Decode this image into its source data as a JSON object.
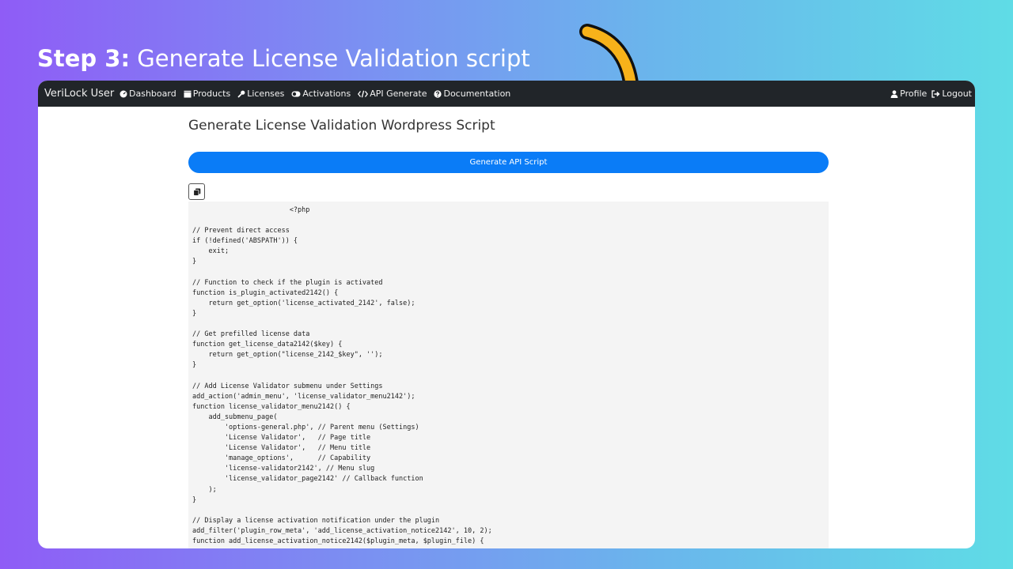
{
  "step": {
    "strong": "Step 3:",
    "rest": " Generate License Validation script"
  },
  "navbar": {
    "brand": "VeriLock User",
    "items": [
      {
        "label": "Dashboard",
        "icon": "dashboard-icon"
      },
      {
        "label": "Products",
        "icon": "products-icon"
      },
      {
        "label": "Licenses",
        "icon": "key-icon"
      },
      {
        "label": "Activations",
        "icon": "toggle-icon"
      },
      {
        "label": "API Generate",
        "icon": "code-icon"
      },
      {
        "label": "Documentation",
        "icon": "question-icon"
      }
    ],
    "right": [
      {
        "label": "Profile",
        "icon": "user-icon"
      },
      {
        "label": "Logout",
        "icon": "logout-icon"
      }
    ]
  },
  "page": {
    "heading": "Generate License Validation Wordpress Script",
    "generate_button": "Generate API Script",
    "copy_icon": "copy-icon"
  },
  "code": "                        <?php\n\n// Prevent direct access\nif (!defined('ABSPATH')) {\n    exit;\n}\n\n// Function to check if the plugin is activated\nfunction is_plugin_activated2142() {\n    return get_option('license_activated_2142', false);\n}\n\n// Get prefilled license data\nfunction get_license_data2142($key) {\n    return get_option(\"license_2142_$key\", '');\n}\n\n// Add License Validator submenu under Settings\nadd_action('admin_menu', 'license_validator_menu2142');\nfunction license_validator_menu2142() {\n    add_submenu_page(\n        'options-general.php', // Parent menu (Settings)\n        'License Validator',   // Page title\n        'License Validator',   // Menu title\n        'manage_options',      // Capability\n        'license-validator2142', // Menu slug\n        'license_validator_page2142' // Callback function\n    );\n}\n\n// Display a license activation notification under the plugin\nadd_filter('plugin_row_meta', 'add_license_activation_notice2142', 10, 2);\nfunction add_license_activation_notice2142($plugin_meta, $plugin_file) {",
  "colors": {
    "navbar": "#212529",
    "button": "#0a7cf7",
    "arrow": "#f7b21a",
    "code_bg": "#f4f4f4"
  }
}
